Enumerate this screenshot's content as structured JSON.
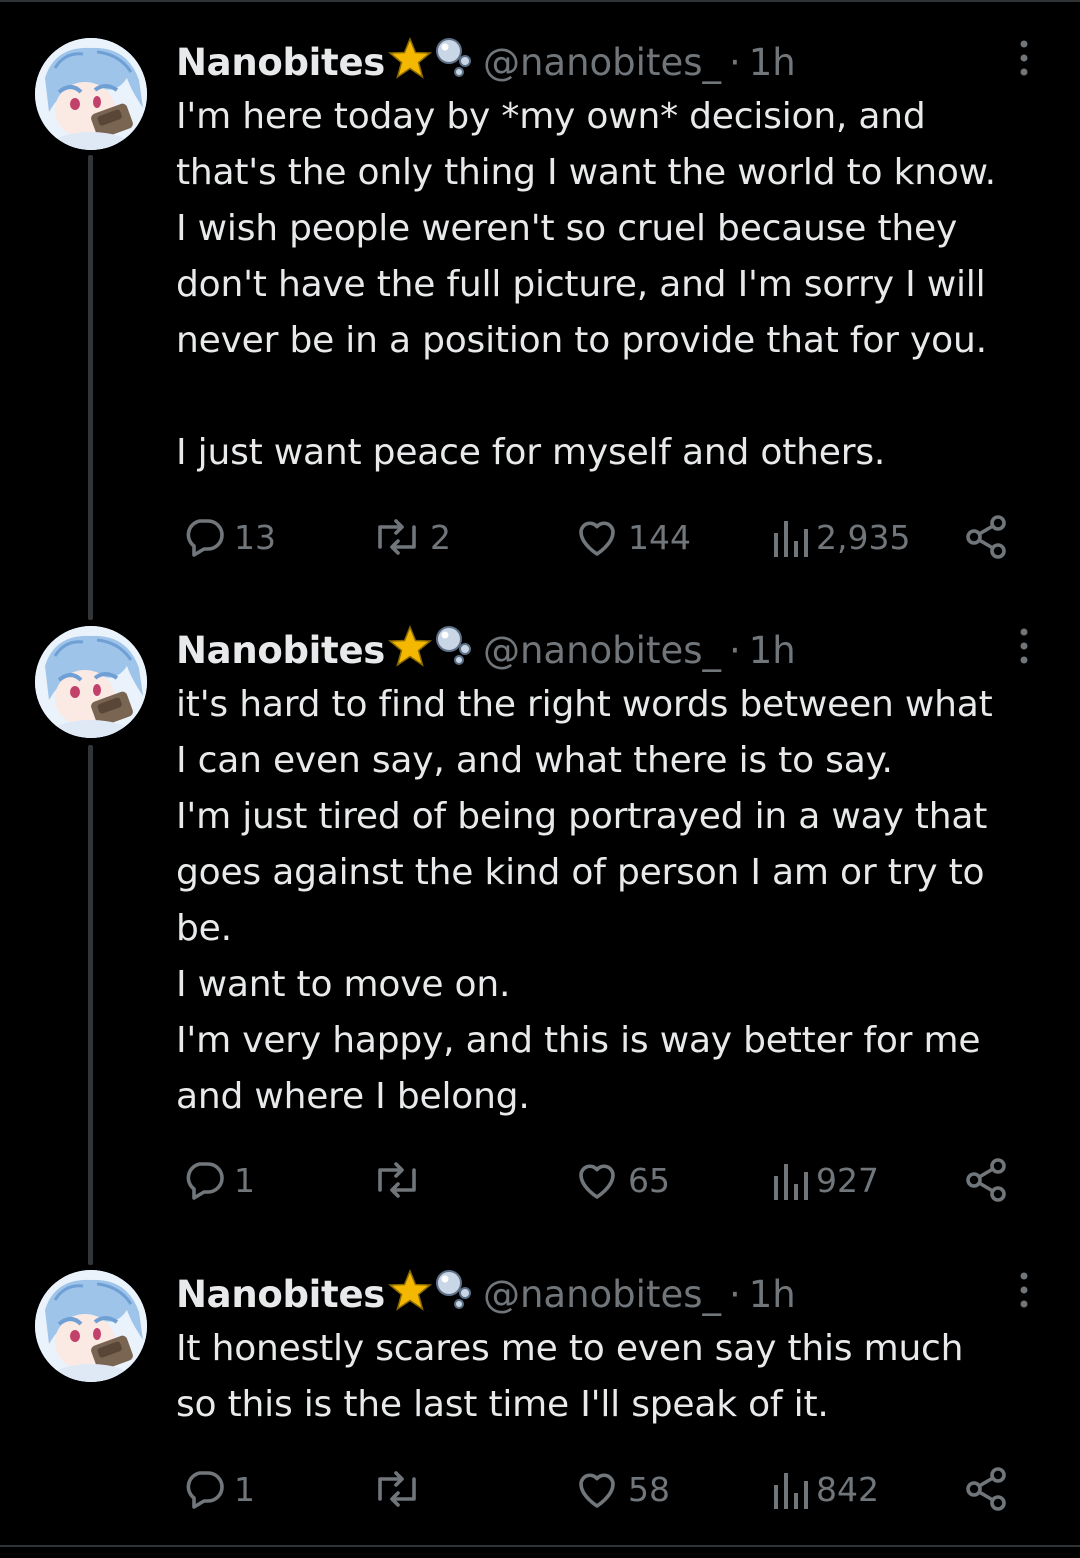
{
  "tweets": [
    {
      "name": "Nanobites",
      "badge_icons": [
        "star-icon",
        "bubbles-icon"
      ],
      "handle": "@nanobites_",
      "separator": "·",
      "time": "1h",
      "text": "I'm here today by *my own* decision, and\nthat's the only thing I want the world to know.\nI wish people weren't so cruel because they\ndon't have the full picture, and I'm sorry I will\nnever be in a position to provide that for you.\n\nI just want peace for myself and others.",
      "replies": "13",
      "reposts": "2",
      "likes": "144",
      "views": "2,935"
    },
    {
      "name": "Nanobites",
      "badge_icons": [
        "star-icon",
        "bubbles-icon"
      ],
      "handle": "@nanobites_",
      "separator": "·",
      "time": "1h",
      "text": "it's hard to find the right words between what\nI can even say, and what there is to say.\nI'm just tired of being portrayed in a way that\ngoes against the kind of person I am or try to\nbe.\nI want to move on.\nI'm very happy, and this is way better for me\nand where I belong.",
      "replies": "1",
      "reposts": "",
      "likes": "65",
      "views": "927"
    },
    {
      "name": "Nanobites",
      "badge_icons": [
        "star-icon",
        "bubbles-icon"
      ],
      "handle": "@nanobites_",
      "separator": "·",
      "time": "1h",
      "text": "It honestly scares me to even say this much\nso this is the last time I'll speak of it.",
      "replies": "1",
      "reposts": "",
      "likes": "58",
      "views": "842"
    }
  ],
  "icons": {
    "reply": "reply-icon",
    "repost": "repost-icon",
    "like": "heart-icon",
    "views": "views-icon",
    "share": "share-icon",
    "more": "more-options-icon",
    "avatar": "avatar"
  },
  "colors": {
    "background": "#000000",
    "text": "#e7e9ea",
    "muted": "#71767b",
    "thread_line": "#333639",
    "star": "#f5b800"
  }
}
